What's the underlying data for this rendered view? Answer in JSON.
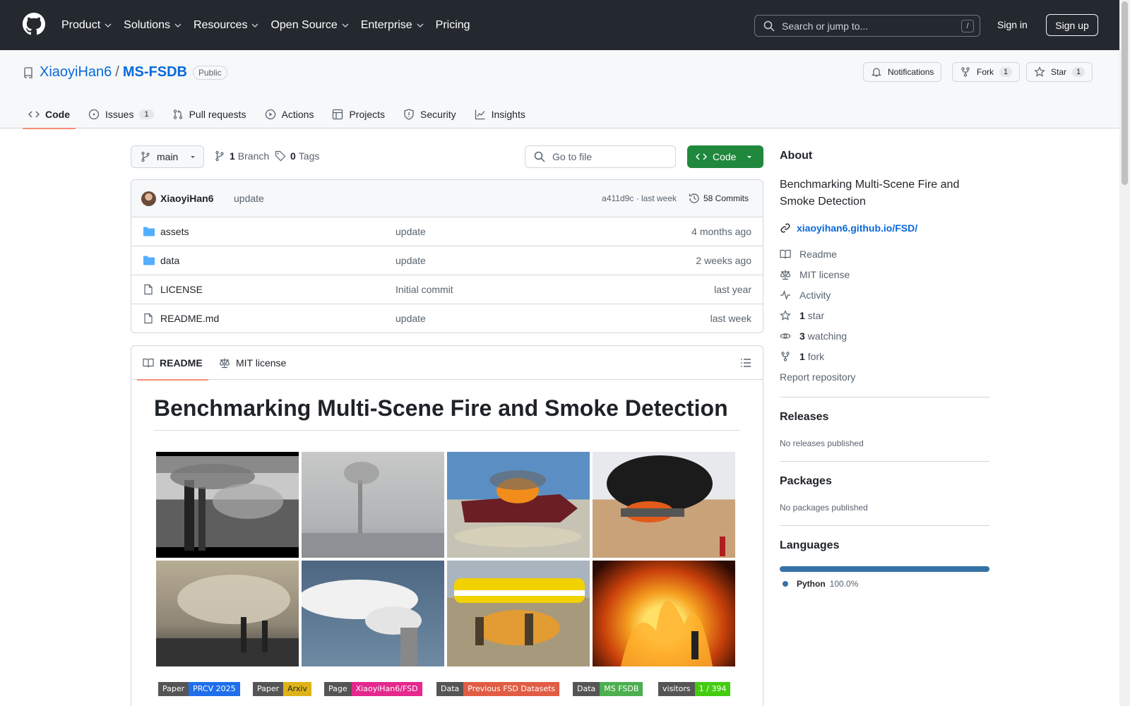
{
  "topnav": {
    "items": [
      "Product",
      "Solutions",
      "Resources",
      "Open Source",
      "Enterprise",
      "Pricing"
    ],
    "search_placeholder": "Search or jump to...",
    "search_shortcut": "/",
    "sign_in": "Sign in",
    "sign_up": "Sign up"
  },
  "repo": {
    "owner": "XiaoyiHan6",
    "separator": "/",
    "name": "MS-FSDB",
    "visibility": "Public",
    "notifications_label": "Notifications",
    "fork_label": "Fork",
    "fork_count": "1",
    "star_label": "Star",
    "star_count": "1"
  },
  "tabs": [
    {
      "label": "Code",
      "active": true
    },
    {
      "label": "Issues",
      "count": "1"
    },
    {
      "label": "Pull requests"
    },
    {
      "label": "Actions"
    },
    {
      "label": "Projects"
    },
    {
      "label": "Security"
    },
    {
      "label": "Insights"
    }
  ],
  "toolbar": {
    "branch": "main",
    "branch_count": "1",
    "branch_label": "Branch",
    "tag_count": "0",
    "tag_label": "Tags",
    "go_to_file": "Go to file",
    "code_button": "Code"
  },
  "commit": {
    "author": "XiaoyiHan6",
    "message": "update",
    "hash_time": "a411d9c · last week",
    "commits_label": "58 Commits"
  },
  "files": [
    {
      "name": "assets",
      "type": "folder",
      "message": "update",
      "age": "4 months ago"
    },
    {
      "name": "data",
      "type": "folder",
      "message": "update",
      "age": "2 weeks ago"
    },
    {
      "name": "LICENSE",
      "type": "file",
      "message": "Initial commit",
      "age": "last year"
    },
    {
      "name": "README.md",
      "type": "file",
      "message": "update",
      "age": "last week"
    }
  ],
  "readme": {
    "tab_readme": "README",
    "tab_license": "MIT license",
    "title": "Benchmarking Multi-Scene Fire and Smoke Detection",
    "badges": [
      {
        "left": "Paper",
        "right": "PRCV 2025",
        "color": "#1f6feb"
      },
      {
        "left": "Paper",
        "right": "Arxiv",
        "color": "#dfb317"
      },
      {
        "left": "Page",
        "right": "XiaoyiHan6/FSD",
        "color": "#e4288d"
      },
      {
        "left": "Data",
        "right": "Previous FSD Datasets",
        "color": "#e05d44"
      },
      {
        "left": "Data",
        "right": "MS FSDB",
        "color": "#4caf50"
      },
      {
        "left": "visitors",
        "right": "1 / 394",
        "color": "#4c1"
      }
    ]
  },
  "about": {
    "heading": "About",
    "description": "Benchmarking Multi-Scene Fire and Smoke Detection",
    "link": "xiaoyihan6.github.io/FSD/",
    "readme": "Readme",
    "license": "MIT license",
    "activity": "Activity",
    "stars_count": "1",
    "stars_label": "star",
    "watching_count": "3",
    "watching_label": "watching",
    "forks_count": "1",
    "forks_label": "fork",
    "report": "Report repository"
  },
  "releases": {
    "heading": "Releases",
    "text": "No releases published"
  },
  "packages": {
    "heading": "Packages",
    "text": "No packages published"
  },
  "languages": {
    "heading": "Languages",
    "items": [
      {
        "name": "Python",
        "percent": "100.0%",
        "color": "#3572A5"
      }
    ]
  },
  "colors": {
    "accent": "#0969da",
    "header_bg": "#24292f",
    "green": "#1f883d",
    "tab_underline": "#fd8c73"
  }
}
